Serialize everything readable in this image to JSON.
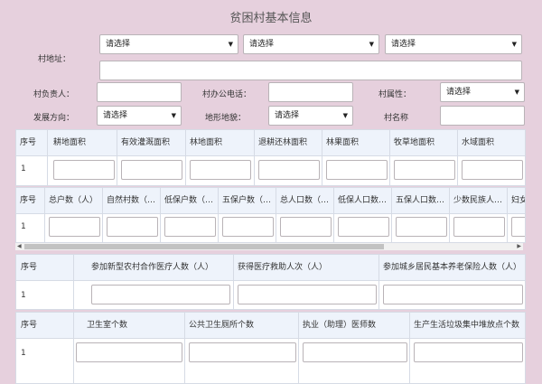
{
  "title": "贫困村基本信息",
  "address": {
    "label": "村地址：",
    "selects": [
      "请选择",
      "请选择",
      "请选择"
    ]
  },
  "row2": {
    "head_label": "村负责人：",
    "phone_label": "村办公电话：",
    "attr_label": "村属性：",
    "attr_value": "请选择"
  },
  "row3": {
    "direction_label": "发展方向：",
    "direction_value": "请选择",
    "terrain_label": "地形地貌：",
    "terrain_value": "请选择",
    "name_label": "村名称"
  },
  "table1": {
    "headers": [
      "序号",
      "耕地面积",
      "有效灌溉面积",
      "林地面积",
      "退耕还林面积",
      "林果面积",
      "牧草地面积",
      "水域面积"
    ],
    "row_no": "1"
  },
  "table2": {
    "headers": [
      "序号",
      "总户数（人）",
      "自然村数（…",
      "低保户数（…",
      "五保户数（…",
      "总人口数（…",
      "低保人口数…",
      "五保人口数…",
      "少数民族人…",
      "妇女"
    ],
    "row_no": "1"
  },
  "table3": {
    "headers": [
      "序号",
      "参加新型农村合作医疗人数（人）",
      "获得医疗救助人次（人）",
      "参加城乡居民基本养老保险人数（人）"
    ],
    "row_no": "1"
  },
  "table4": {
    "headers": [
      "序号",
      "卫生室个数",
      "公共卫生厕所个数",
      "执业（助理）医师数",
      "生产生活垃圾集中堆放点个数"
    ],
    "row_no": "1"
  },
  "icons": {
    "dropdown": "caret-down-icon",
    "scroll_left": "caret-left-icon",
    "scroll_right": "caret-right-icon"
  }
}
